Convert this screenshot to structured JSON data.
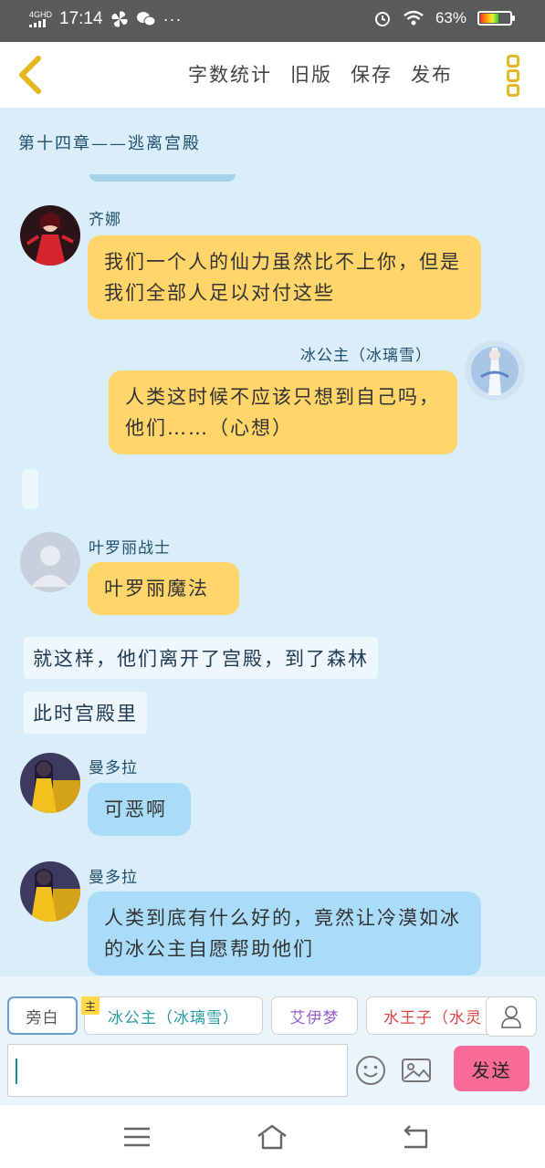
{
  "status_bar": {
    "network": "4GHD",
    "time": "17:14",
    "extra_icons": [
      "pinwheel-icon",
      "wechat-icon",
      "more-dots"
    ],
    "battery": "63%",
    "battery_level": 0.63
  },
  "toolbar": {
    "word_count": "字数统计",
    "old_version": "旧版",
    "save": "保存",
    "publish": "发布"
  },
  "chapter_title": "第十四章——逃离宫殿",
  "messages": [
    {
      "name": "齐娜",
      "text": "我们一个人的仙力虽然比不上你，但是我们全部人足以对付这些"
    },
    {
      "name": "冰公主（冰璃雪）",
      "text": "人类这时候不应该只想到自己吗，他们……（心想）"
    },
    {
      "name": "叶罗丽战士",
      "text": "叶罗丽魔法"
    },
    {
      "narration": "就这样，他们离开了宫殿，到了森林"
    },
    {
      "narration": "此时宫殿里"
    },
    {
      "name": "曼多拉",
      "text": "可恶啊"
    },
    {
      "name": "曼多拉",
      "text": "人类到底有什么好的，竟然让冷漠如冰的冰公主自愿帮助他们"
    }
  ],
  "characters": {
    "narrator": "旁白",
    "main_tag": "主",
    "c1": "冰公主（冰璃雪）",
    "c2": "艾伊梦",
    "c3": "水王子（水灵"
  },
  "input": {
    "value": ""
  },
  "send": "发送",
  "colors": {
    "yellow_bubble": "#ffd56a",
    "blue_bubble": "#a9dcf9",
    "send": "#f86b96",
    "accent": "#e3b81f"
  }
}
